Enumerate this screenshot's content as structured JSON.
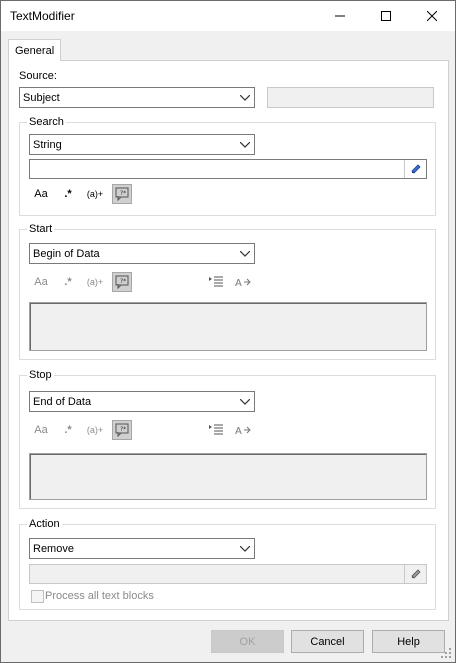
{
  "window": {
    "title": "TextModifier"
  },
  "tabs": [
    {
      "label": "General"
    }
  ],
  "source": {
    "label": "Source:",
    "value": "Subject",
    "extra_value": ""
  },
  "search": {
    "label": "Search",
    "type_value": "String",
    "text_value": "",
    "tools": [
      "Aa",
      ".*",
      "(a)+"
    ]
  },
  "start": {
    "label": "Start",
    "value": "Begin of Data",
    "tools": [
      "Aa",
      ".*",
      "(a)+"
    ],
    "text": ""
  },
  "stop": {
    "label": "Stop",
    "value": "End of Data",
    "tools": [
      "Aa",
      ".*",
      "(a)+"
    ],
    "text": ""
  },
  "action": {
    "label": "Action",
    "value": "Remove",
    "text_value": "",
    "checkbox_label": "Process all text blocks",
    "checkbox_checked": false
  },
  "buttons": {
    "ok": "OK",
    "cancel": "Cancel",
    "help": "Help"
  },
  "icons": {
    "tb": [
      "minimize-icon",
      "maximize-icon",
      "close-icon"
    ],
    "tools": [
      "case-sensitive-icon",
      "regex-icon",
      "group-icon",
      "wildcard-icon",
      "indent-icon",
      "text-direction-icon",
      "pick-icon"
    ]
  },
  "colors": {
    "window_bg": "#f0f0f0",
    "panel_bg": "#ffffff",
    "disabled_text": "#a0a0a0"
  }
}
